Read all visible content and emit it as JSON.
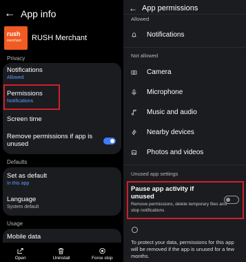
{
  "left": {
    "header": {
      "back_icon": "←",
      "title": "App info"
    },
    "app": {
      "logo_line1": "rush",
      "logo_line2": "merchant",
      "name": "RUSH Merchant",
      "logo_color": "#f15a22"
    },
    "sections": {
      "privacy": "Privacy",
      "defaults": "Defaults",
      "usage": "Usage"
    },
    "privacy_items": {
      "notifications": {
        "title": "Notifications",
        "sub": "Allowed"
      },
      "permissions": {
        "title": "Permissions",
        "sub": "Notifications"
      },
      "screen_time": {
        "title": "Screen time"
      },
      "remove_perms": {
        "title": "Remove permissions if app is unused"
      }
    },
    "default_items": {
      "set_default": {
        "title": "Set as default",
        "sub": "In this app"
      },
      "language": {
        "title": "Language",
        "sub": "System default"
      }
    },
    "usage_items": {
      "mobile_data": {
        "title": "Mobile data"
      }
    },
    "bottom_bar": {
      "open": "Open",
      "uninstall": "Uninstall",
      "force_stop": "Force stop"
    }
  },
  "right": {
    "header": {
      "back_icon": "←",
      "title": "App permissions"
    },
    "allowed_label": "Allowed",
    "allowed": [
      {
        "name": "Notifications",
        "icon": "bell-icon"
      }
    ],
    "not_allowed_label": "Not allowed",
    "not_allowed": [
      {
        "name": "Camera",
        "icon": "camera-icon"
      },
      {
        "name": "Microphone",
        "icon": "microphone-icon"
      },
      {
        "name": "Music and audio",
        "icon": "music-icon"
      },
      {
        "name": "Nearby devices",
        "icon": "nearby-devices-icon"
      },
      {
        "name": "Photos and videos",
        "icon": "photos-icon"
      }
    ],
    "unused_label": "Unused app settings",
    "pause": {
      "title": "Pause app activity if unused",
      "sub": "Remove permissions, delete temporary files and stop notifications"
    },
    "info_text": "To protect your data, permissions for this app will be removed if the app is unused for a few months."
  },
  "colors": {
    "accent_blue": "#5b9bff",
    "toggle_on": "#3e7cff",
    "highlight_red": "#d0202a",
    "card_bg": "#1b1c20"
  }
}
